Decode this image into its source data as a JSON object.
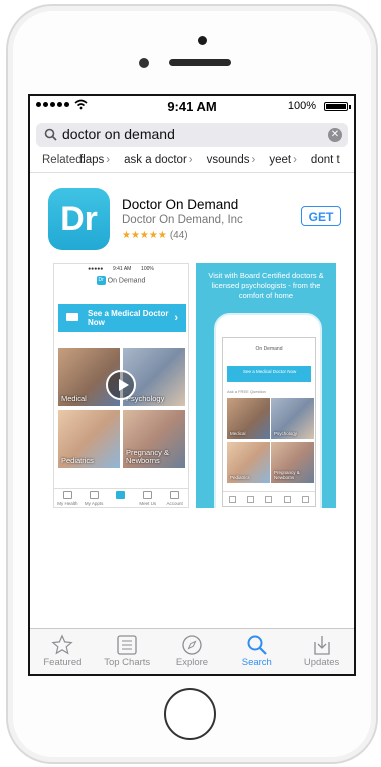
{
  "status": {
    "time": "9:41 AM",
    "battery": "100%"
  },
  "search": {
    "query": "doctor on demand"
  },
  "related": {
    "label": "Related:",
    "tags": [
      "flaps",
      "ask a doctor",
      "vsounds",
      "yeet",
      "dont t"
    ]
  },
  "app": {
    "icon_text": "Dr",
    "name": "Doctor On Demand",
    "developer": "Doctor On Demand, Inc",
    "stars": "★★★★★",
    "rating_count": "(44)",
    "get_label": "GET"
  },
  "screenshot1": {
    "title": "On Demand",
    "logo": "Dr",
    "cta": "See a Medical Doctor Now",
    "tiles": [
      "Medical",
      "Psychology",
      "Pediatrics",
      "Pregnancy & Newborns"
    ],
    "tabs": [
      "My Health",
      "My Appts",
      "",
      "Meet Us",
      "Account"
    ]
  },
  "screenshot2": {
    "caption": "Visit with Board Certified doctors & licensed psychologists - from the comfort of home",
    "title": "On Demand",
    "cta": "See a Medical Doctor Now",
    "question": "Ask a FREE Question",
    "tiles": [
      "Medical",
      "Psychology",
      "Pediatrics",
      "Pregnancy & Newborns"
    ]
  },
  "tabbar": {
    "items": [
      {
        "label": "Featured",
        "icon": "star-icon"
      },
      {
        "label": "Top Charts",
        "icon": "list-icon"
      },
      {
        "label": "Explore",
        "icon": "compass-icon"
      },
      {
        "label": "Search",
        "icon": "search-icon"
      },
      {
        "label": "Updates",
        "icon": "download-icon"
      }
    ],
    "active_index": 3,
    "accent": "#2f8ef2"
  }
}
